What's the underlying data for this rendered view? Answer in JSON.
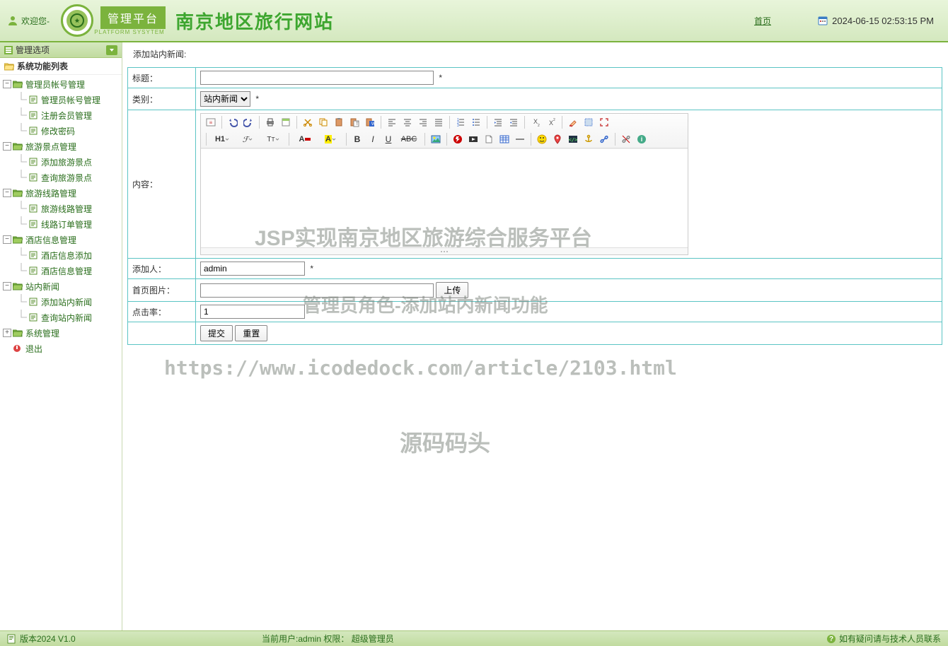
{
  "header": {
    "welcome": "欢迎您-",
    "platform_label": "管理平台",
    "platform_sub": "PLATFORM SYSYTEM",
    "site_title": "南京地区旅行网站",
    "home_link": "首页",
    "datetime": "2024-06-15 02:53:15 PM"
  },
  "sidebar": {
    "menu_header": "管理选项",
    "section_title": "系统功能列表",
    "groups": [
      {
        "label": "管理员帐号管理",
        "children": [
          {
            "label": "管理员帐号管理"
          },
          {
            "label": "注册会员管理"
          },
          {
            "label": "修改密码"
          }
        ]
      },
      {
        "label": "旅游景点管理",
        "children": [
          {
            "label": "添加旅游景点"
          },
          {
            "label": "查询旅游景点"
          }
        ]
      },
      {
        "label": "旅游线路管理",
        "children": [
          {
            "label": "旅游线路管理"
          },
          {
            "label": "线路订单管理"
          }
        ]
      },
      {
        "label": "酒店信息管理",
        "children": [
          {
            "label": "酒店信息添加"
          },
          {
            "label": "酒店信息管理"
          }
        ]
      },
      {
        "label": "站内新闻",
        "children": [
          {
            "label": "添加站内新闻"
          },
          {
            "label": "查询站内新闻"
          }
        ]
      },
      {
        "label": "系统管理",
        "collapsed": true
      },
      {
        "label": "退出",
        "is_exit": true
      }
    ]
  },
  "main": {
    "section_title": "添加站内新闻:",
    "fields": {
      "title_label": "标题：",
      "category_label": "类别：",
      "content_label": "内容：",
      "author_label": "添加人：",
      "image_label": "首页图片：",
      "hits_label": "点击率：",
      "title_value": "",
      "category_selected": "站内新闻",
      "category_options": [
        "站内新闻"
      ],
      "author_value": "admin",
      "image_value": "",
      "upload_btn": "上传",
      "hits_value": "1",
      "submit_btn": "提交",
      "reset_btn": "重置",
      "required_mark": "*"
    },
    "editor_icons": [
      "source",
      "undo",
      "redo",
      "print",
      "template",
      "cut",
      "copy",
      "paste",
      "paste-text",
      "paste-word",
      "align-left",
      "align-center",
      "align-right",
      "align-justify",
      "ol",
      "ul",
      "indent",
      "outdent",
      "subscript",
      "superscript",
      "clear-format",
      "select-all",
      "fullscreen",
      "heading",
      "font-family",
      "font-size",
      "text-color",
      "highlight",
      "bold",
      "italic",
      "underline",
      "strike",
      "image",
      "flash",
      "media",
      "file",
      "table",
      "hr",
      "emoji",
      "map",
      "code",
      "anchor",
      "link",
      "unlink",
      "about"
    ]
  },
  "footer": {
    "version": "版本2024 V1.0",
    "current_user_label": "当前用户:",
    "current_user_value": "admin",
    "role_label": "权限：",
    "role_value": "超级管理员",
    "help_text": "如有疑问请与技术人员联系"
  },
  "watermarks": {
    "w1": "JSP实现南京地区旅游综合服务平台",
    "w2": "管理员角色-添加站内新闻功能",
    "w3": "https://www.icodedock.com/article/2103.html",
    "w4": "源码码头"
  },
  "colors": {
    "primary_green": "#7bb33d",
    "teal_border": "#5bc4c4"
  }
}
